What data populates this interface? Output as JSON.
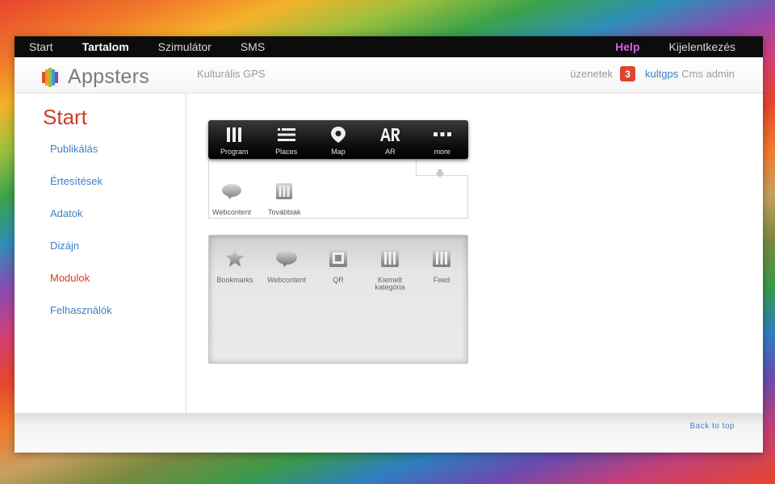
{
  "topnav": {
    "items": [
      {
        "label": "Start",
        "active": false
      },
      {
        "label": "Tartalom",
        "active": true
      },
      {
        "label": "Szimulátor",
        "active": false
      },
      {
        "label": "SMS",
        "active": false
      }
    ],
    "help_label": "Help",
    "logout_label": "Kijelentkezés"
  },
  "header": {
    "brand": "Appsters",
    "app_name": "Kulturális GPS",
    "messages_label": "üzenetek",
    "messages_count": "3",
    "username": "kultgps",
    "role": "Cms admin"
  },
  "sidebar": {
    "title": "Start",
    "items": [
      {
        "label": "Publikálás",
        "current": false
      },
      {
        "label": "Értesítések",
        "current": false
      },
      {
        "label": "Adatok",
        "current": false
      },
      {
        "label": "Dizájn",
        "current": false
      },
      {
        "label": "Modulok",
        "current": true
      },
      {
        "label": "Felhasználók",
        "current": false
      }
    ]
  },
  "tabbar": {
    "tabs": [
      {
        "label": "Program",
        "icon": "columns-icon"
      },
      {
        "label": "Places",
        "icon": "list-icon"
      },
      {
        "label": "Map",
        "icon": "map-pin-icon"
      },
      {
        "label": "AR",
        "icon": "ar-icon"
      },
      {
        "label": "more",
        "icon": "more-icon"
      }
    ]
  },
  "more_modules": {
    "items": [
      {
        "label": "Webcontent",
        "icon": "webcontent-icon"
      },
      {
        "label": "Továbbiak",
        "icon": "columns-icon"
      }
    ]
  },
  "available_modules": {
    "items": [
      {
        "label": "Bookmarks",
        "icon": "star-icon"
      },
      {
        "label": "Webcontent",
        "icon": "webcontent-icon"
      },
      {
        "label": "QR",
        "icon": "qr-icon"
      },
      {
        "label": "Kiemelt kategória",
        "icon": "columns-icon"
      },
      {
        "label": "Feed",
        "icon": "columns-icon"
      }
    ]
  },
  "footer": {
    "back_to_top": "Back to top"
  },
  "colors": {
    "accent_red": "#d33b28",
    "link_blue": "#3d7fc6",
    "help_purple": "#d45ee8",
    "badge_red": "#e0452c"
  }
}
